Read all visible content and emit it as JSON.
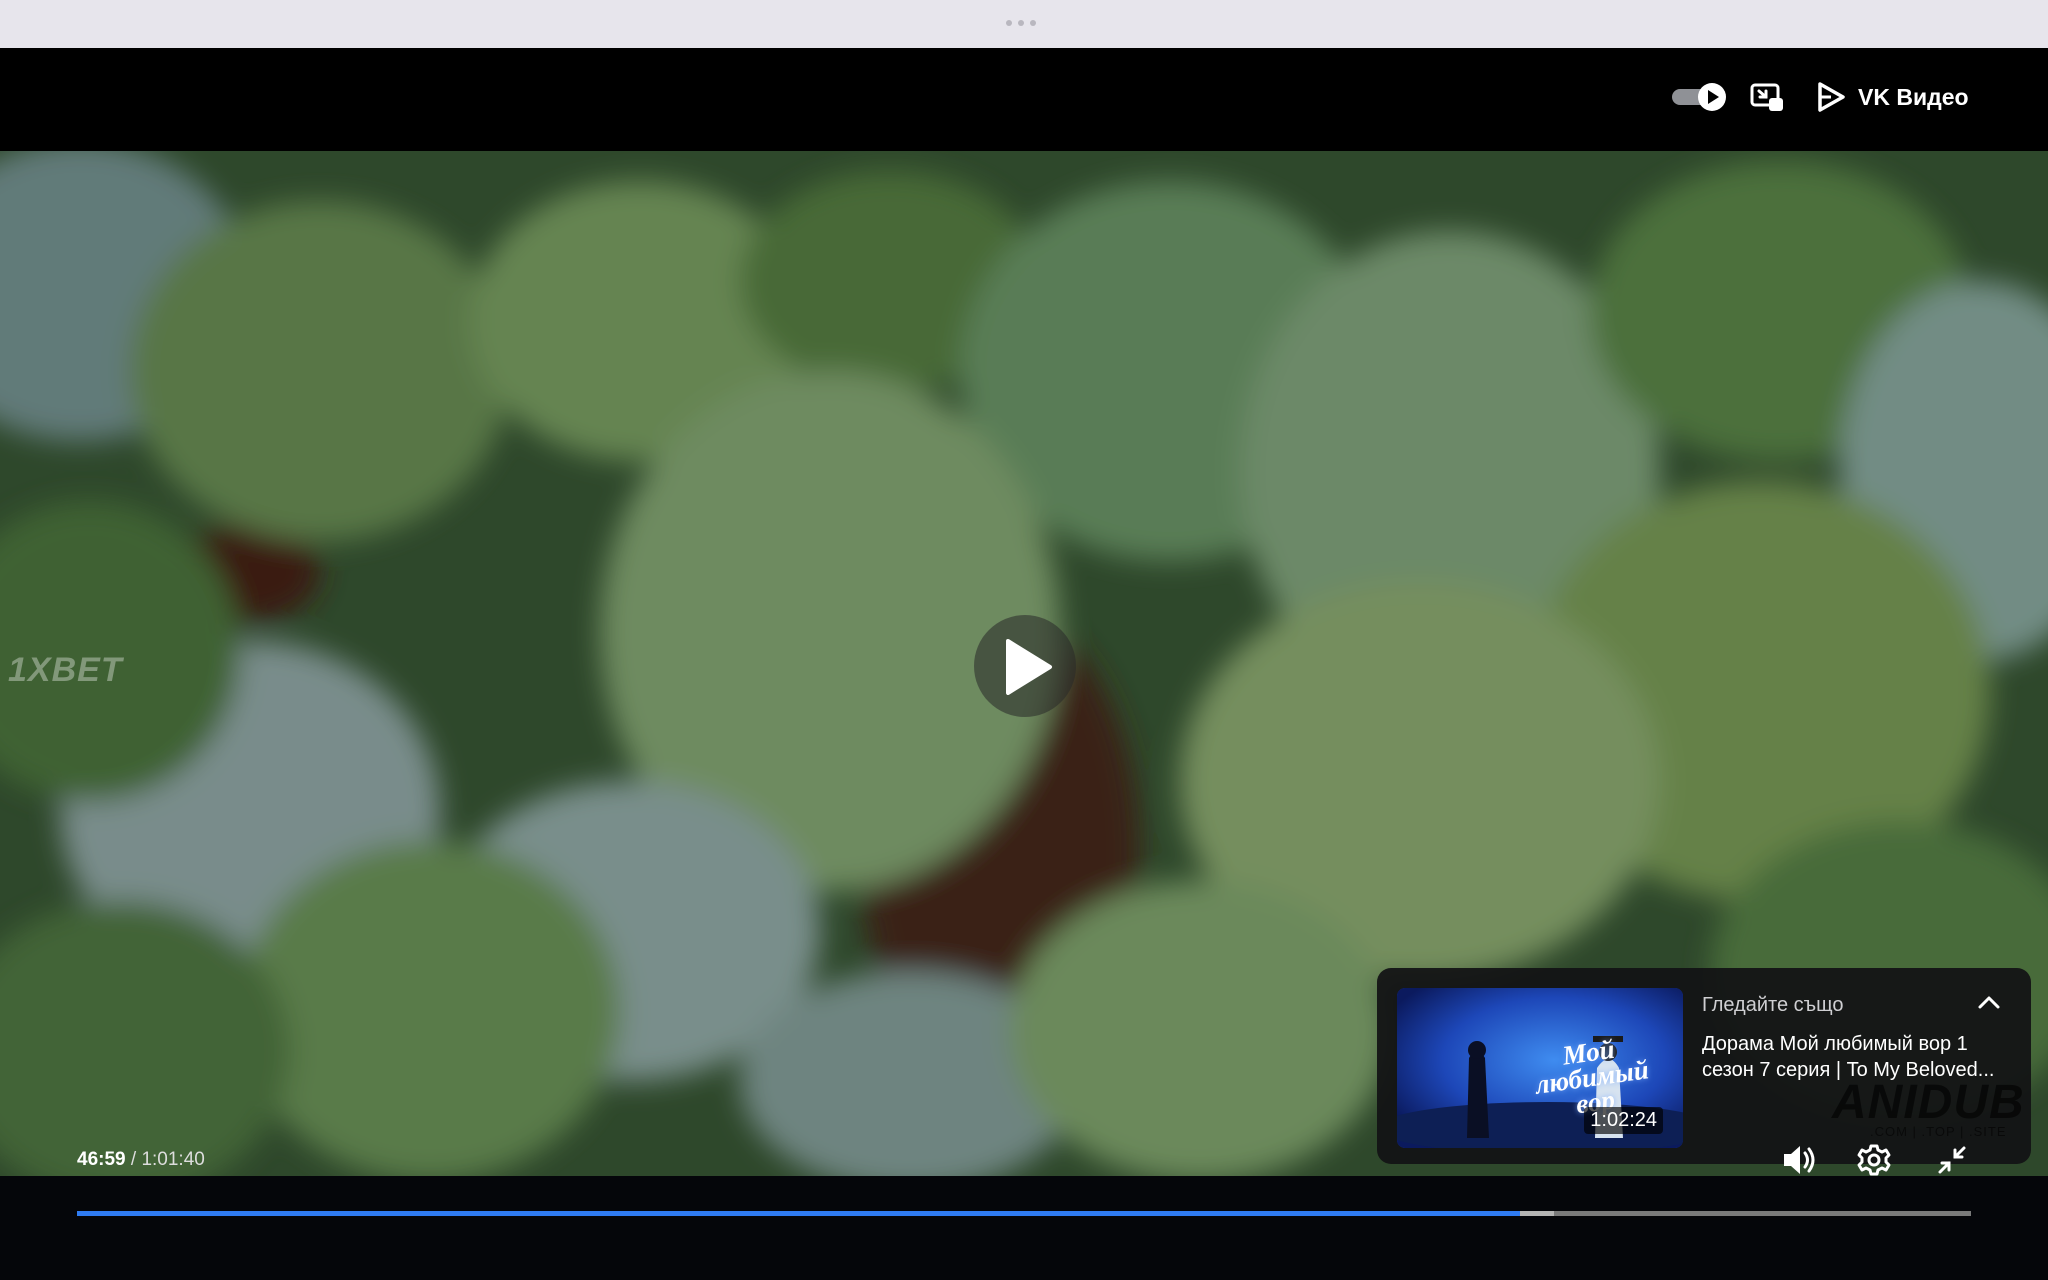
{
  "window": {
    "header": {
      "brand_label": "VK Видео",
      "autoplay_toggle_on": true
    }
  },
  "player": {
    "left_watermark": "1XBET",
    "time": {
      "current": "46:59",
      "separator": "/",
      "duration": "1:01:40"
    },
    "progress": {
      "played_fraction": 0.762,
      "buffered_fraction": 0.78
    },
    "colors": {
      "accent": "#2f7bf2",
      "track": "#7a7a7a"
    }
  },
  "recommendation": {
    "heading": "Гледайте също",
    "title": "Дорама Мой любимый вор 1 сезон 7 серия | To My Beloved...",
    "thumb_title": "Мой любимый вор",
    "thumb_duration": "1:02:24",
    "overlay_watermark": "ANIDUB",
    "overlay_watermark_sub": ".COM | .TOP | .SITE"
  },
  "icons": {
    "autoplay": "play-toggle-icon",
    "cast": "picture-in-picture-icon",
    "vk": "vk-play-icon",
    "play": "play-icon",
    "collapse": "chevron-up-icon",
    "volume": "volume-icon",
    "settings": "gear-icon",
    "exit_fullscreen": "minimize-icon"
  }
}
